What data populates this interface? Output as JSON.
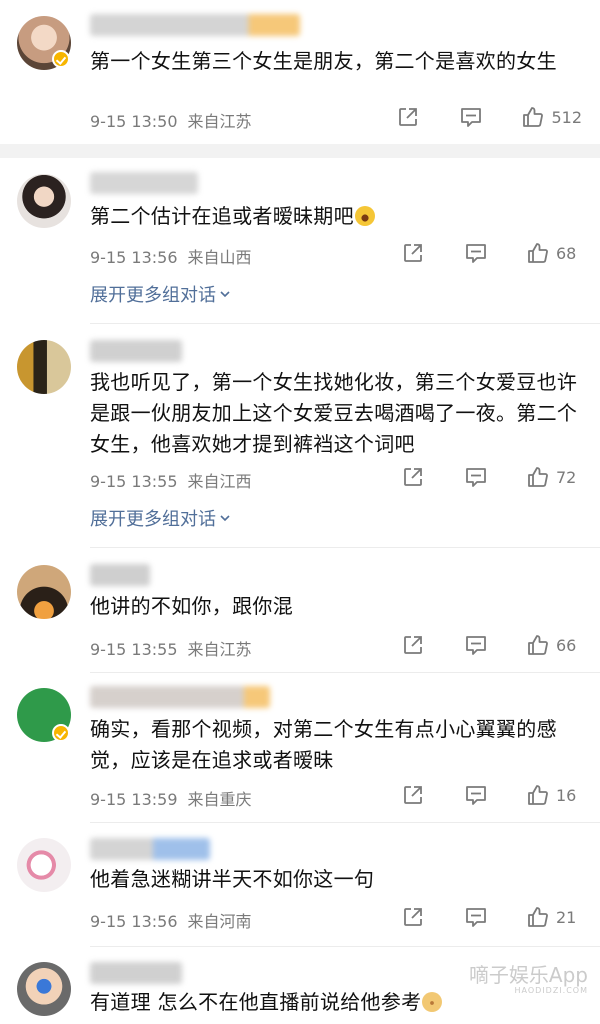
{
  "comments": [
    {
      "text": "第一个女生第三个女生是朋友，第二个是喜欢的女生",
      "time": "9-15 13:50",
      "location": "来自江苏",
      "likes": "512",
      "verified": true
    },
    {
      "text": "第二个估计在追或者暧昧期吧",
      "time": "9-15 13:56",
      "location": "来自山西",
      "likes": "68",
      "expand_label": "展开更多组对话"
    },
    {
      "text": "我也听见了，第一个女生找她化妆，第三个女爱豆也许是跟一伙朋友加上这个女爱豆去喝酒喝了一夜。第二个女生，他喜欢她才提到裤裆这个词吧",
      "time": "9-15 13:55",
      "location": "来自江西",
      "likes": "72",
      "expand_label": "展开更多组对话"
    },
    {
      "text": "他讲的不如你，跟你混",
      "time": "9-15 13:55",
      "location": "来自江苏",
      "likes": "66"
    },
    {
      "text": "确实，看那个视频，对第二个女生有点小心翼翼的感觉，应该是在追求或者暧昧",
      "time": "9-15 13:59",
      "location": "来自重庆",
      "likes": "16",
      "verified": true
    },
    {
      "text": "他着急迷糊讲半天不如你这一句",
      "time": "9-15 13:56",
      "location": "来自河南",
      "likes": "21"
    },
    {
      "text": "有道理 怎么不在他直播前说给他参考",
      "verified": true
    }
  ],
  "watermark": {
    "main": "嘀子娱乐App",
    "sub": "HAODIDZI.COM"
  },
  "colors": {
    "link": "#516f99",
    "meta": "#7a7a7a",
    "badge": "#f7b500",
    "separator": "#f2f2f2"
  },
  "icons": [
    "share-icon",
    "reply-icon",
    "like-icon",
    "chevron-down-icon",
    "verified-icon"
  ]
}
